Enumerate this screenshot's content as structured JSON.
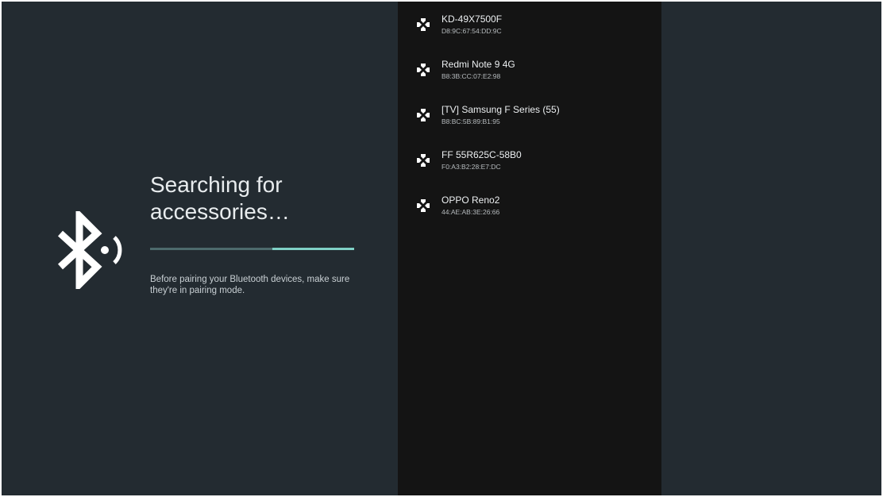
{
  "search": {
    "title": "Searching for\naccessories…",
    "progress_fraction": 0.4,
    "hint": "Before pairing your Bluetooth devices, make sure they're in pairing mode."
  },
  "devices": [
    {
      "name": "KD-49X7500F",
      "mac": "D8:9C:67:54:DD:9C",
      "icon": "gamepad-icon"
    },
    {
      "name": "Redmi Note 9 4G",
      "mac": "B8:3B:CC:07:E2:98",
      "icon": "gamepad-icon"
    },
    {
      "name": "[TV] Samsung F Series (55)",
      "mac": "B8:BC:5B:89:B1:95",
      "icon": "gamepad-icon"
    },
    {
      "name": "FF 55R625C-58B0",
      "mac": "F0:A3:B2:28:E7:DC",
      "icon": "gamepad-icon"
    },
    {
      "name": "OPPO Reno2",
      "mac": "44:AE:AB:3E:26:66",
      "icon": "gamepad-icon"
    }
  ],
  "colors": {
    "background": "#232b31",
    "device_panel": "#141414",
    "progress_track": "#4d6a6c",
    "progress_fill": "#7fd1c6"
  }
}
